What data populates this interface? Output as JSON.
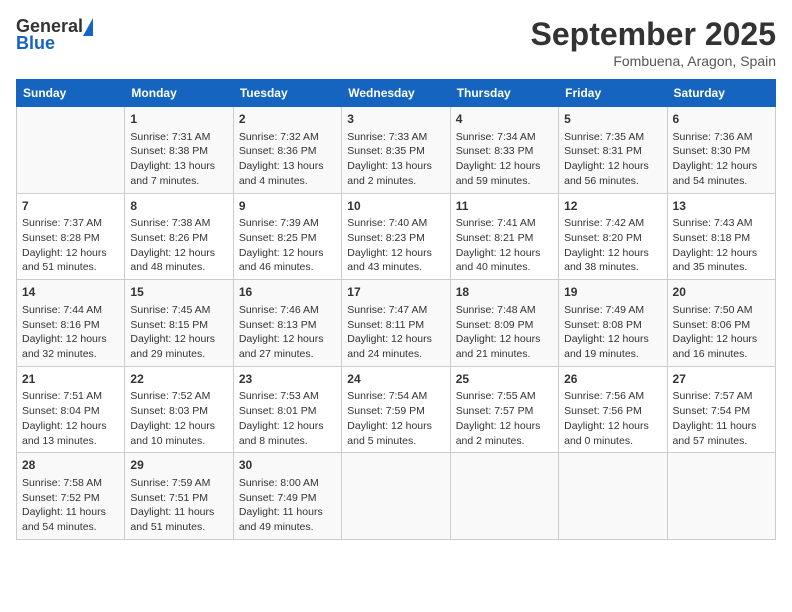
{
  "logo": {
    "general": "General",
    "blue": "Blue"
  },
  "title": "September 2025",
  "subtitle": "Fombuena, Aragon, Spain",
  "days_of_week": [
    "Sunday",
    "Monday",
    "Tuesday",
    "Wednesday",
    "Thursday",
    "Friday",
    "Saturday"
  ],
  "weeks": [
    [
      {
        "day": "",
        "info": ""
      },
      {
        "day": "1",
        "info": "Sunrise: 7:31 AM\nSunset: 8:38 PM\nDaylight: 13 hours\nand 7 minutes."
      },
      {
        "day": "2",
        "info": "Sunrise: 7:32 AM\nSunset: 8:36 PM\nDaylight: 13 hours\nand 4 minutes."
      },
      {
        "day": "3",
        "info": "Sunrise: 7:33 AM\nSunset: 8:35 PM\nDaylight: 13 hours\nand 2 minutes."
      },
      {
        "day": "4",
        "info": "Sunrise: 7:34 AM\nSunset: 8:33 PM\nDaylight: 12 hours\nand 59 minutes."
      },
      {
        "day": "5",
        "info": "Sunrise: 7:35 AM\nSunset: 8:31 PM\nDaylight: 12 hours\nand 56 minutes."
      },
      {
        "day": "6",
        "info": "Sunrise: 7:36 AM\nSunset: 8:30 PM\nDaylight: 12 hours\nand 54 minutes."
      }
    ],
    [
      {
        "day": "7",
        "info": "Sunrise: 7:37 AM\nSunset: 8:28 PM\nDaylight: 12 hours\nand 51 minutes."
      },
      {
        "day": "8",
        "info": "Sunrise: 7:38 AM\nSunset: 8:26 PM\nDaylight: 12 hours\nand 48 minutes."
      },
      {
        "day": "9",
        "info": "Sunrise: 7:39 AM\nSunset: 8:25 PM\nDaylight: 12 hours\nand 46 minutes."
      },
      {
        "day": "10",
        "info": "Sunrise: 7:40 AM\nSunset: 8:23 PM\nDaylight: 12 hours\nand 43 minutes."
      },
      {
        "day": "11",
        "info": "Sunrise: 7:41 AM\nSunset: 8:21 PM\nDaylight: 12 hours\nand 40 minutes."
      },
      {
        "day": "12",
        "info": "Sunrise: 7:42 AM\nSunset: 8:20 PM\nDaylight: 12 hours\nand 38 minutes."
      },
      {
        "day": "13",
        "info": "Sunrise: 7:43 AM\nSunset: 8:18 PM\nDaylight: 12 hours\nand 35 minutes."
      }
    ],
    [
      {
        "day": "14",
        "info": "Sunrise: 7:44 AM\nSunset: 8:16 PM\nDaylight: 12 hours\nand 32 minutes."
      },
      {
        "day": "15",
        "info": "Sunrise: 7:45 AM\nSunset: 8:15 PM\nDaylight: 12 hours\nand 29 minutes."
      },
      {
        "day": "16",
        "info": "Sunrise: 7:46 AM\nSunset: 8:13 PM\nDaylight: 12 hours\nand 27 minutes."
      },
      {
        "day": "17",
        "info": "Sunrise: 7:47 AM\nSunset: 8:11 PM\nDaylight: 12 hours\nand 24 minutes."
      },
      {
        "day": "18",
        "info": "Sunrise: 7:48 AM\nSunset: 8:09 PM\nDaylight: 12 hours\nand 21 minutes."
      },
      {
        "day": "19",
        "info": "Sunrise: 7:49 AM\nSunset: 8:08 PM\nDaylight: 12 hours\nand 19 minutes."
      },
      {
        "day": "20",
        "info": "Sunrise: 7:50 AM\nSunset: 8:06 PM\nDaylight: 12 hours\nand 16 minutes."
      }
    ],
    [
      {
        "day": "21",
        "info": "Sunrise: 7:51 AM\nSunset: 8:04 PM\nDaylight: 12 hours\nand 13 minutes."
      },
      {
        "day": "22",
        "info": "Sunrise: 7:52 AM\nSunset: 8:03 PM\nDaylight: 12 hours\nand 10 minutes."
      },
      {
        "day": "23",
        "info": "Sunrise: 7:53 AM\nSunset: 8:01 PM\nDaylight: 12 hours\nand 8 minutes."
      },
      {
        "day": "24",
        "info": "Sunrise: 7:54 AM\nSunset: 7:59 PM\nDaylight: 12 hours\nand 5 minutes."
      },
      {
        "day": "25",
        "info": "Sunrise: 7:55 AM\nSunset: 7:57 PM\nDaylight: 12 hours\nand 2 minutes."
      },
      {
        "day": "26",
        "info": "Sunrise: 7:56 AM\nSunset: 7:56 PM\nDaylight: 12 hours\nand 0 minutes."
      },
      {
        "day": "27",
        "info": "Sunrise: 7:57 AM\nSunset: 7:54 PM\nDaylight: 11 hours\nand 57 minutes."
      }
    ],
    [
      {
        "day": "28",
        "info": "Sunrise: 7:58 AM\nSunset: 7:52 PM\nDaylight: 11 hours\nand 54 minutes."
      },
      {
        "day": "29",
        "info": "Sunrise: 7:59 AM\nSunset: 7:51 PM\nDaylight: 11 hours\nand 51 minutes."
      },
      {
        "day": "30",
        "info": "Sunrise: 8:00 AM\nSunset: 7:49 PM\nDaylight: 11 hours\nand 49 minutes."
      },
      {
        "day": "",
        "info": ""
      },
      {
        "day": "",
        "info": ""
      },
      {
        "day": "",
        "info": ""
      },
      {
        "day": "",
        "info": ""
      }
    ]
  ]
}
